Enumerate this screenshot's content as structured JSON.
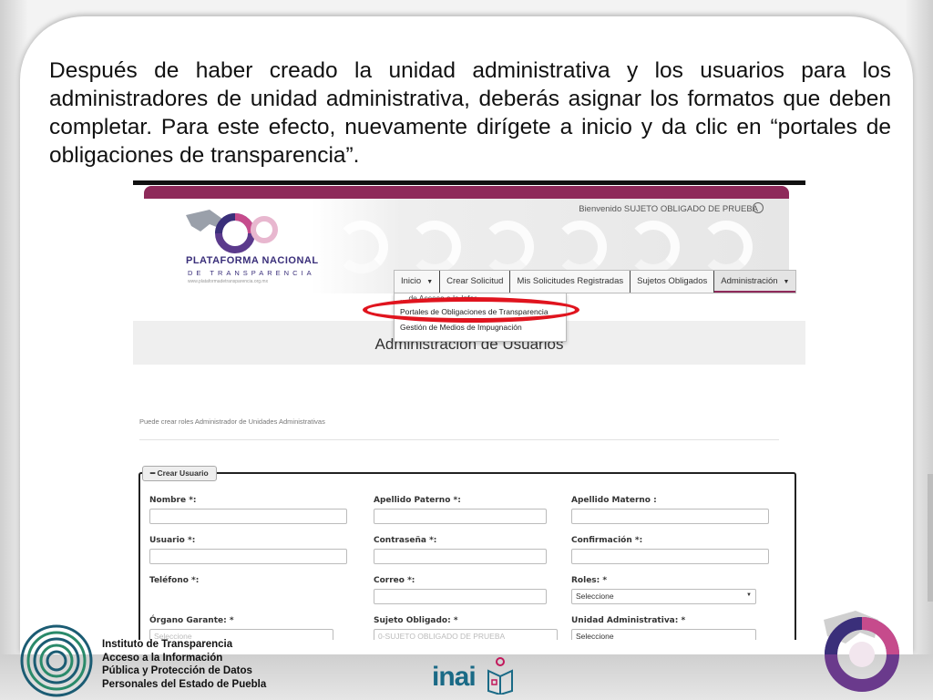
{
  "slide": {
    "instruction": "Después de haber creado la unidad administrativa y los usuarios para los administradores de unidad administrativa, deberás asignar los formatos que deben completar. Para este efecto, nuevamente dirígete a inicio y da clic en “portales de obligaciones de transparencia”."
  },
  "portal": {
    "welcome": "Bienvenido SUJETO OBLIGADO DE PRUEBA",
    "logo": {
      "title": "PLATAFORMA NACIONAL",
      "subtitle": "DE TRANSPARENCIA",
      "url": "www.plataformadetransparencia.org.mx"
    },
    "nav": {
      "inicio": "Inicio",
      "crear_solicitud": "Crear Solicitud",
      "mis_solicitudes": "Mis Solicitudes Registradas",
      "sujetos": "Sujetos Obligados",
      "administracion": "Administración"
    },
    "dropdown": {
      "item_cut": "... de Acceso a la Infor...",
      "portales": "Portales de Obligaciones de Transparencia",
      "medios": "Gestión de Medios de Impugnación"
    },
    "page_title": "Administración de Usuarios",
    "roles_note": "Puede crear roles Administrador de Unidades Administrativas",
    "form": {
      "tab": "━ Crear Usuario",
      "nombre": "Nombre *:",
      "apellido_paterno": "Apellido Paterno *:",
      "apellido_materno": "Apellido Materno :",
      "usuario": "Usuario *:",
      "contrasena": "Contraseña *:",
      "confirmacion": "Confirmación *:",
      "telefono": "Teléfono *:",
      "correo": "Correo *:",
      "roles": "Roles: *",
      "roles_value": "Seleccione",
      "organo_garante": "Órgano Garante: *",
      "organo_value": "Seleccione",
      "sujeto_obligado": "Sujeto Obligado: *",
      "sujeto_value": "0-SUJETO OBLIGADO DE PRUEBA",
      "unidad_administrativa": "Unidad Administrativa: *",
      "unidad_value": "Seleccione"
    }
  },
  "footer": {
    "institute_line1": "Instituto de Transparencia",
    "institute_line2": "Acceso a la Información",
    "institute_line3": "Pública y Protección de Datos",
    "institute_line4": "Personales del Estado de Puebla",
    "inai": "inai"
  },
  "colors": {
    "portal_accent": "#8e2a5a",
    "highlight": "#e0141e",
    "inai_blue": "#1a6a86"
  }
}
